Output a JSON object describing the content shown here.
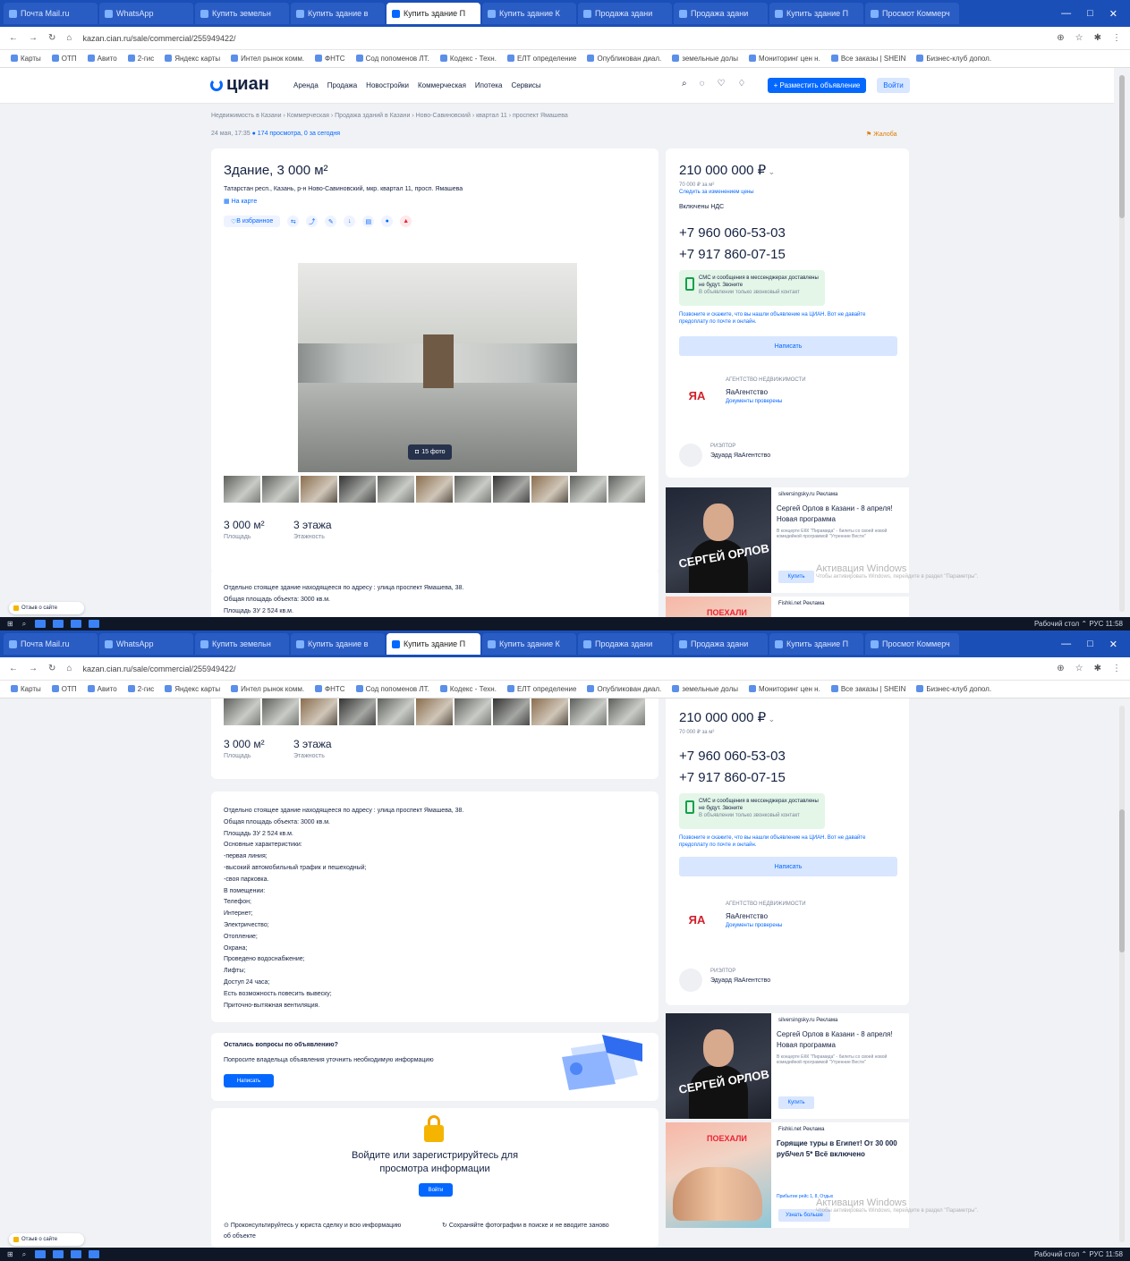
{
  "browser": {
    "tabs": [
      "Почта Mail.ru",
      "WhatsApp",
      "Купить земельн",
      "Купить здание в",
      "Купить здание П",
      "Купить здание К",
      "Продажа здани",
      "Продажа здани",
      "Купить здание П",
      "Просмот Коммерч"
    ],
    "active_tab": 4,
    "url": "kazan.cian.ru/sale/commercial/255949422/",
    "bookmarks": [
      "Карты",
      "ОТП",
      "Авито",
      "2-гис",
      "Яндекс карты",
      "Интел рынок комм.",
      "ФНТС",
      "Сод попоменов ЛТ.",
      "Кодекс - Техн.",
      "ЕЛТ определение",
      "Опубликован диал.",
      "земельные долы",
      "Мониторинг цен н.",
      "Все заказы | SHEIN",
      "Бизнес-клуб допол."
    ],
    "window_controls": [
      "—",
      "□",
      "✕"
    ]
  },
  "site": {
    "logo": "циан",
    "nav": [
      "Аренда",
      "Продажа",
      "Новостройки",
      "Коммерческая",
      "Ипотека",
      "Сервисы"
    ],
    "post_button": "+ Разместить объявление",
    "login_button": "Войти"
  },
  "listing": {
    "breadcrumbs": "Недвижимость в Казани › Коммерческая › Продажа зданий в Казани › Ново-Савиновский › квартал 11 › проспект Ямашева",
    "date": "24 мая, 17:35",
    "views": "174 просмотра, 0 за сегодня",
    "report": "Жалоба",
    "title": "Здание, 3 000 м²",
    "address": "Татарстан респ., Казань, р-н Ново-Савиновский, мкр. квартал 11, просп. Ямашева",
    "map_link": "На карте",
    "favorite": "В избранное",
    "photo_count": "15 фото",
    "stats": [
      {
        "value": "3 000 м²",
        "label": "Площадь"
      },
      {
        "value": "3 этажа",
        "label": "Этажность"
      }
    ],
    "description": [
      "Отдельно стоящее здание находящееся по адресу : улица проспект Ямашева, 38.",
      "Общая площадь объекта: 3000 кв.м.",
      "Площадь ЗУ 2 524 кв.м.",
      "Основные характеристики:",
      "-первая линия;",
      "-высокий автомобильный трафик и пешеходный;",
      "-своя парковка.",
      "В помещении:",
      "Телефон;",
      "Интернет;",
      "Электричество;",
      "Отопление;",
      "Охрана;",
      "Проведено водоснабжение;",
      "Лифты;",
      "Доступ 24 часа;",
      "Есть возможность повесить вывеску;",
      "Приточно-вытяжная вентиляция."
    ],
    "edit_question": "Остались вопросы по объявлению?",
    "edit_text": "Попросите владельца объявления уточнить необходимую информацию",
    "edit_button": "Написать",
    "signin_text": "Войдите или зарегистрируйтесь для просмотра информации",
    "signin_button": "Войти",
    "tips": [
      "Проконсультируйтесь у юриста сделку и всю информацию об объекте",
      "Сохраняйте фотографии в поиске и не вводите заново"
    ]
  },
  "sidebar": {
    "price": "210 000 000 ₽",
    "price_per_m2": "70 000 ₽ за м²",
    "watch_price": "Следить за изменением цены",
    "vat": "Включены НДС",
    "phones": [
      "+7 960 060-53-03",
      "+7 917 860-07-15"
    ],
    "sms_title": "СМС и сообщения в мессенджерах доставлены не будут. Звоните",
    "sms_note": "В объявлении только звонковый контакт",
    "warning": "Позвоните и скажите, что вы нашли объявление на ЦИАН. Вот не давайте предоплату по почте и онлайн.",
    "write_button": "Написать",
    "agency_label": "АГЕНТСТВО НЕДВИЖИМОСТИ",
    "agency_name": "ЯаАгентство",
    "agency_logo": "ЯА",
    "agency_verified": "Документы проверены",
    "realtor_label": "РИЭЛТОР",
    "realtor_name": "Эдуард ЯаАгентство"
  },
  "ads": {
    "ad1_source": "silversingsky.ru  Реклама",
    "ad1_headline": "Сергей Орлов в Казани - 8 апреля! Новая программа",
    "ad1_sub": "В концерте ЕКК \"Пирамида\" - билеты со своей новой комедийной программой \"Утренние Вести\"",
    "ad1_caption": "СЕРГЕЙ ОРЛОВ",
    "ad1_button": "Купить",
    "ad2_source": "Fishki.net  Реклама",
    "ad2_headline": "Горящие туры в Египет! От 30 000 руб/чел 5* Всё включено",
    "ad2_sub": "Прибытие рейс 1, 8, Отдых",
    "ad2_caption": "ПОЕХАЛИ",
    "ad2_button": "Узнать больше"
  },
  "os": {
    "windows_watermark": "Активация Windows",
    "windows_watermark_sub": "Чтобы активировать Windows, перейдите в раздел \"Параметры\".",
    "feedback": "Отзыв о сайте",
    "tray": "Рабочий стол  ⌃  РУС  11:58"
  }
}
